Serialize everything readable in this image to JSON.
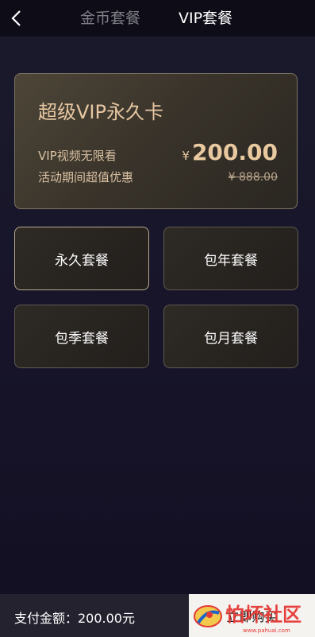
{
  "header": {
    "back_icon": "chevron-left-icon",
    "tabs": [
      {
        "label": "金币套餐",
        "active": false
      },
      {
        "label": "VIP套餐",
        "active": true
      }
    ]
  },
  "featured_card": {
    "title": "超级VIP永久卡",
    "line1": "VIP视频无限看",
    "line2": "活动期间超值优惠",
    "currency": "¥",
    "price": "200.00",
    "original_price": "¥ 888.00"
  },
  "packages": [
    {
      "label": "永久套餐",
      "selected": true
    },
    {
      "label": "包年套餐",
      "selected": false
    },
    {
      "label": "包季套餐",
      "selected": false
    },
    {
      "label": "包月套餐",
      "selected": false
    }
  ],
  "footer": {
    "pay_label": "支付金额：200.00元",
    "buy_button": "立即购买"
  },
  "watermark": {
    "text": "怕坏社区",
    "url_text": "www.pahuai.com"
  },
  "colors": {
    "gold": "#e6c7a2",
    "background": "#17142a",
    "topbar": "#0e0d17"
  }
}
